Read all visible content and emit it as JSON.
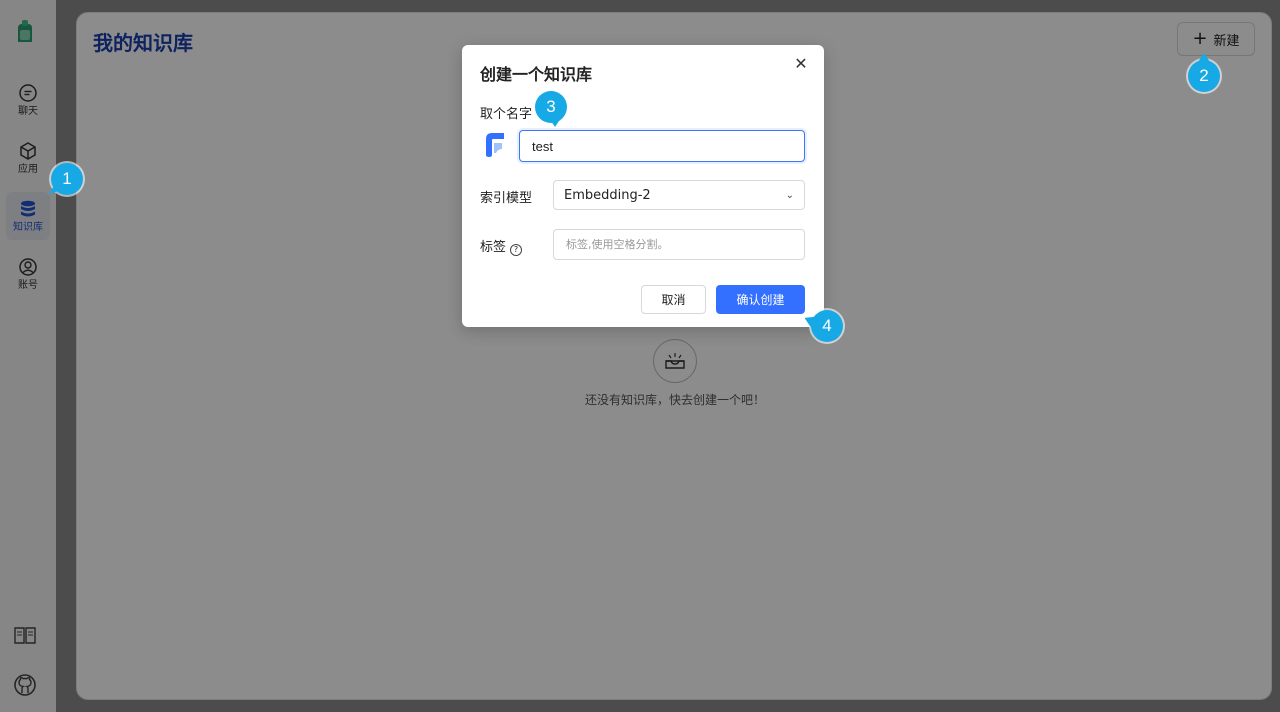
{
  "sidebar": {
    "items": [
      {
        "label": "聊天",
        "icon": "chat-icon"
      },
      {
        "label": "应用",
        "icon": "cube-icon"
      },
      {
        "label": "知识库",
        "icon": "database-icon",
        "active": true
      },
      {
        "label": "账号",
        "icon": "user-icon"
      }
    ],
    "bottom_icons": [
      "book-icon",
      "github-icon"
    ]
  },
  "header": {
    "title": "我的知识库",
    "new_button": "新建"
  },
  "empty_state": {
    "icon": "empty-box-icon",
    "text": "还没有知识库，快去创建一个吧！"
  },
  "modal": {
    "title": "创建一个知识库",
    "name_label": "取个名字",
    "name_value": "test",
    "model_label": "索引模型",
    "model_value": "Embedding-2",
    "tags_label": "标签",
    "tags_placeholder": "标签,使用空格分割。",
    "cancel": "取消",
    "confirm": "确认创建"
  },
  "markers": [
    "1",
    "2",
    "3",
    "4"
  ],
  "colors": {
    "accent": "#3370ff",
    "marker": "#17a9e6",
    "title": "#1b3fae"
  }
}
